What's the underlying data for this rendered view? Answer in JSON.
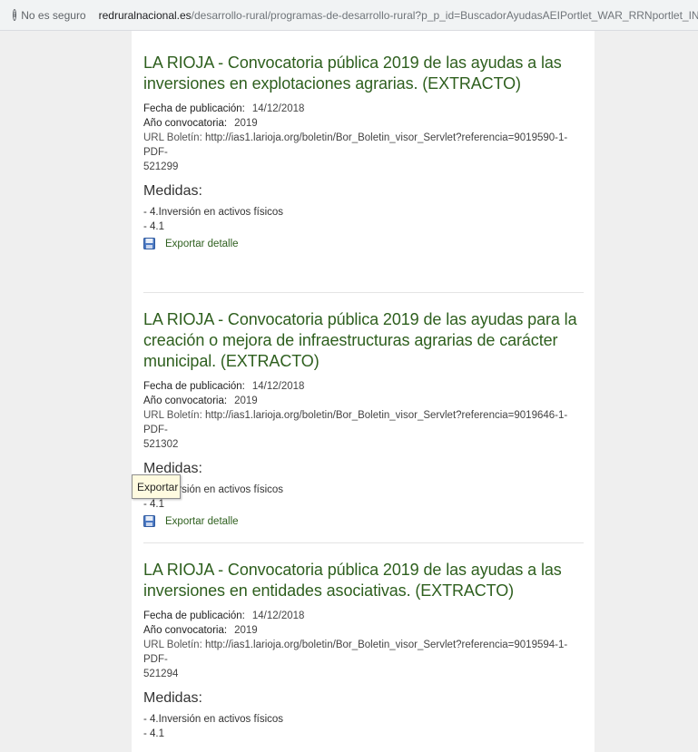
{
  "browser": {
    "security_label": "No es seguro",
    "url_host": "redruralnacional.es",
    "url_path": "/desarrollo-rural/programas-de-desarrollo-rural?p_p_id=BuscadorAyudasAEIPortlet_WAR_RRNportlet_INSTANCE_Lcb"
  },
  "labels": {
    "fecha": "Fecha de publicación:",
    "anio": "Año convocatoria:",
    "url": "URL Boletín:",
    "medidas": "Medidas:",
    "export": "Exportar detalle"
  },
  "entries": [
    {
      "title": "LA RIOJA - Convocatoria pública 2019 de las ayudas a las inversiones en explotaciones agrarias. (EXTRACTO)",
      "fecha": "14/12/2018",
      "anio": "2019",
      "url_line1": "http://ias1.larioja.org/boletin/Bor_Boletin_visor_Servlet?referencia=9019590-1-PDF-",
      "url_line2": "521299",
      "medida_1": "- 4.Inversión en activos físicos",
      "medida_2": "- 4.1"
    },
    {
      "title": "LA RIOJA - Convocatoria pública 2019 de las ayudas para la creación o mejora de infraestructuras agrarias de carácter municipal. (EXTRACTO)",
      "fecha": "14/12/2018",
      "anio": "2019",
      "url_line1": "http://ias1.larioja.org/boletin/Bor_Boletin_visor_Servlet?referencia=9019646-1-PDF-",
      "url_line2": "521302",
      "medida_1": "- 4.Inversión en activos físicos",
      "medida_2": "- 4.1"
    },
    {
      "title": "LA RIOJA - Convocatoria pública 2019 de las ayudas a las inversiones en entidades asociativas. (EXTRACTO)",
      "fecha": "14/12/2018",
      "anio": "2019",
      "url_line1": "http://ias1.larioja.org/boletin/Bor_Boletin_visor_Servlet?referencia=9019594-1-PDF-",
      "url_line2": "521294",
      "medida_1": "- 4.Inversión en activos físicos",
      "medida_2": "- 4.1"
    }
  ],
  "tooltip": "Exportar"
}
